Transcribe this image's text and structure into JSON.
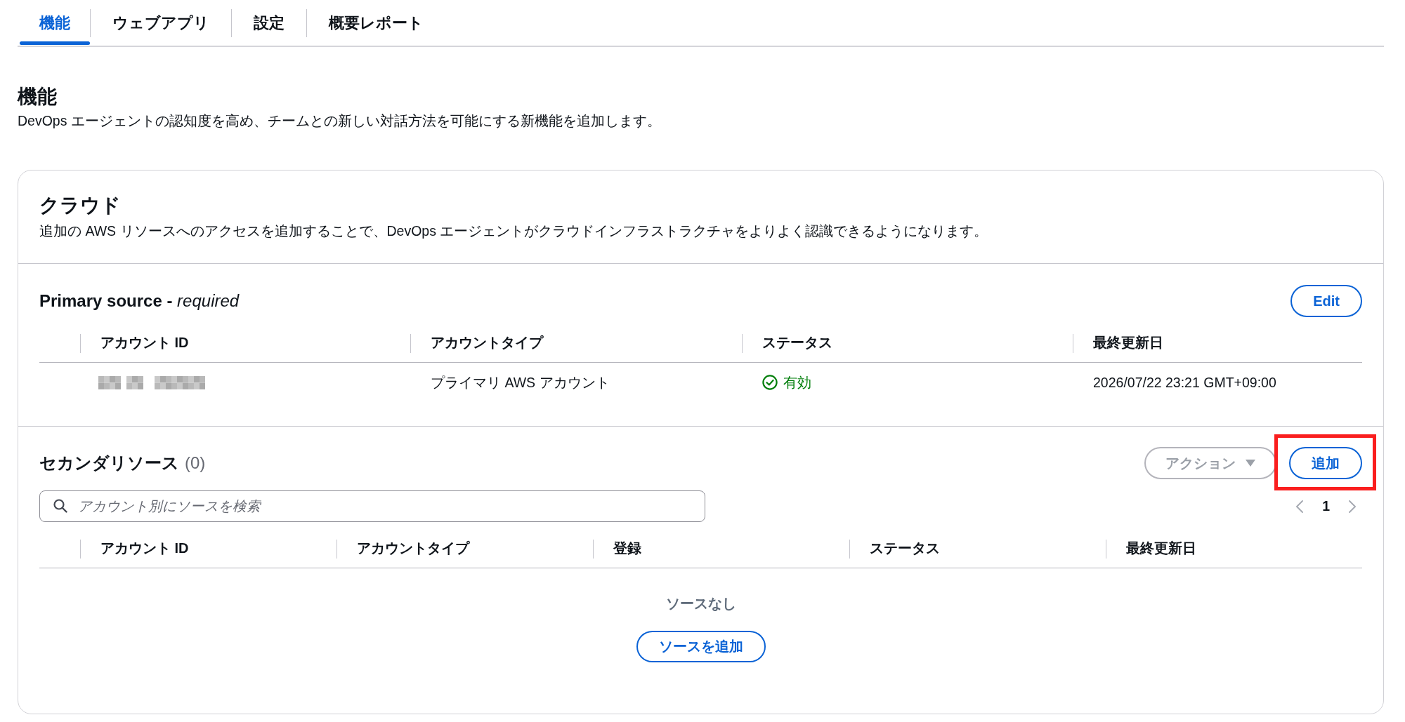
{
  "tabs": [
    {
      "label": "機能",
      "selected": true
    },
    {
      "label": "ウェブアプリ",
      "selected": false
    },
    {
      "label": "設定",
      "selected": false
    },
    {
      "label": "概要レポート",
      "selected": false
    }
  ],
  "page": {
    "title": "機能",
    "description": "DevOps エージェントの認知度を高め、チームとの新しい対話方法を可能にする新機能を追加します。"
  },
  "cloud_panel": {
    "title": "クラウド",
    "description": "追加の AWS リソースへのアクセスを追加することで、DevOps エージェントがクラウドインフラストラクチャをよりよく認識できるようになります。",
    "primary_source": {
      "title": "Primary source - *required*",
      "edit_button": "Edit",
      "columns": [
        "アカウント ID",
        "アカウントタイプ",
        "ステータス",
        "最終更新日"
      ],
      "rows": [
        {
          "account_id": {
            "redacted": true
          },
          "account_type": "プライマリ AWS アカウント",
          "status": {
            "label": "有効",
            "kind": "active"
          },
          "last_updated": "2026/07/22 23:21 GMT+09:00"
        }
      ]
    },
    "secondary_sources": {
      "title": "セカンダリソース",
      "count": "(0)",
      "actions_button": {
        "label": "アクション",
        "disabled": true
      },
      "add_button": {
        "label": "追加",
        "highlighted": true
      },
      "search": {
        "placeholder": "アカウント別にソースを検索"
      },
      "pagination": {
        "previous_disabled": true,
        "next_disabled": true,
        "pages": [
          {
            "label": "1",
            "selected": true
          }
        ]
      },
      "columns": [
        "アカウント ID",
        "アカウントタイプ",
        "登録",
        "ステータス",
        "最終更新日"
      ],
      "empty_state": {
        "message": "ソースなし",
        "button": "ソースを追加"
      }
    }
  }
}
